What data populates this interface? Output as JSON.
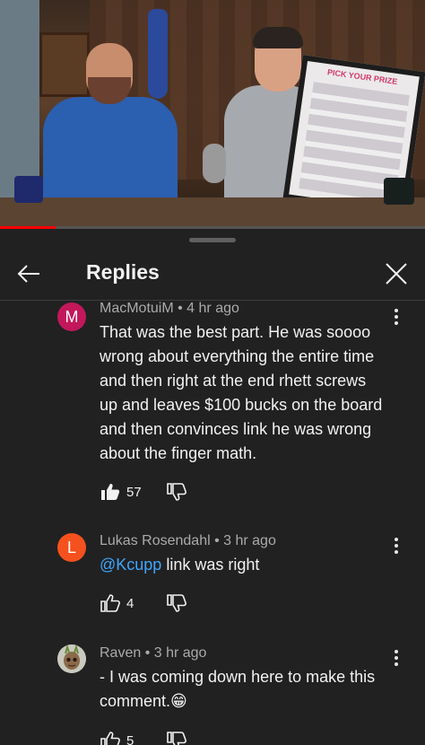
{
  "panel": {
    "title": "Replies"
  },
  "comments": [
    {
      "avatar_letter": "M",
      "avatar_color": "#c2185b",
      "meta": "MacMotuiM • 4 hr ago",
      "text": "That was the best part. He was soooo wrong about everything the entire time and then right at the end rhett screws up and leaves $100 bucks on the board and then convinces link he was wrong about the finger math.",
      "likes": "57",
      "liked": true
    },
    {
      "avatar_letter": "L",
      "avatar_color": "#f4511e",
      "meta": "Lukas Rosendahl • 3 hr ago",
      "mention": "@Kcupp",
      "text": "link was right",
      "likes": "4",
      "liked": false
    },
    {
      "avatar_icon": "groot-avatar-icon",
      "meta": "Raven • 3 hr ago",
      "text": "- I was coming down here to make this comment.😁",
      "likes": "5",
      "liked": false
    }
  ],
  "video": {
    "board_title": "PICK YOUR PRIZE",
    "progress_fraction": 0.13
  },
  "colors": {
    "background": "#212121",
    "text": "#f1f1f1",
    "secondary_text": "#aaaaaa",
    "link": "#3ea6ff",
    "progress": "#ff0000"
  }
}
